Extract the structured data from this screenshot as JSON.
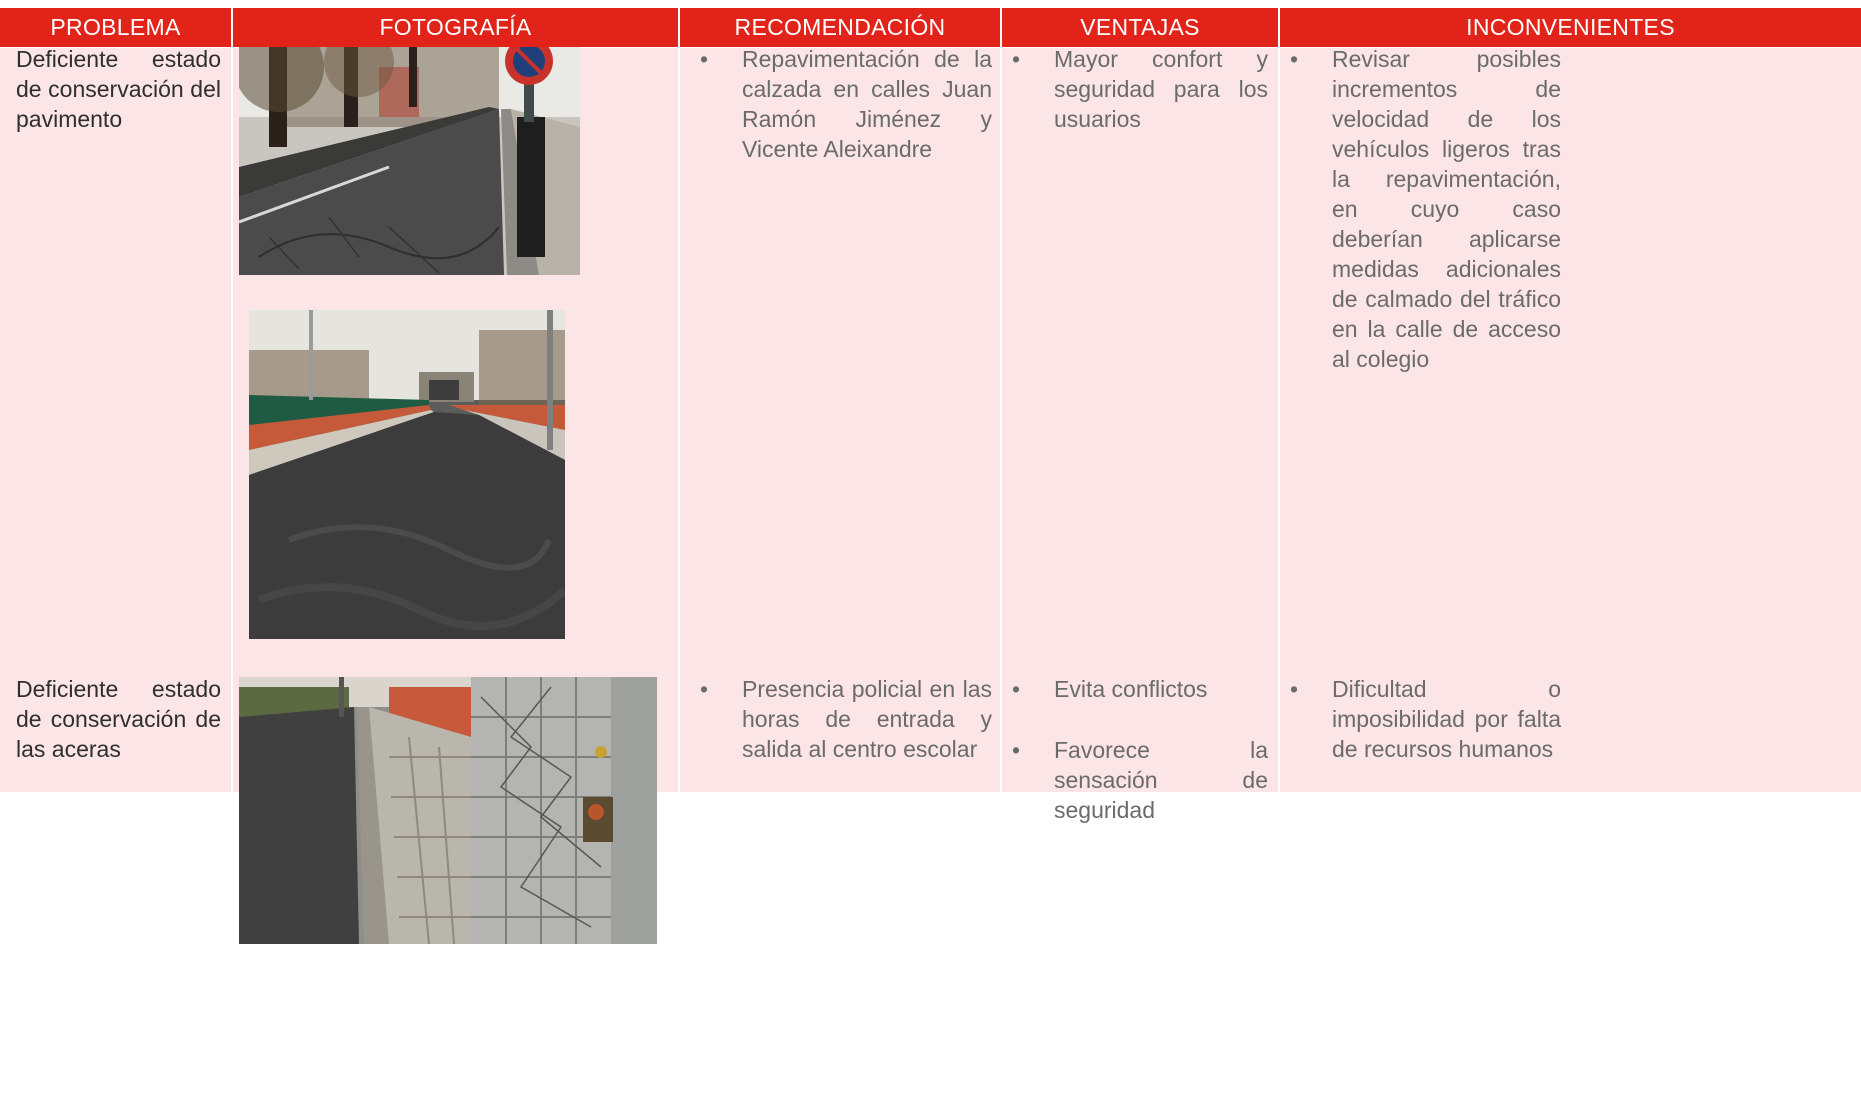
{
  "header": {
    "problema": "PROBLEMA",
    "fotografia": "FOTOGRAFÍA",
    "recomendacion": "RECOMENDACIÓN",
    "ventajas": "VENTAJAS",
    "inconvenientes": "INCONVENIENTES"
  },
  "colors": {
    "header_bg": "#e2231a",
    "row_tint": "#fbe5e6"
  },
  "rows": [
    {
      "problema": "Deficiente estado de conservación del pavimento",
      "recomendacion": [
        "Repavimentación de la calzada en calles Juan Ramón Jiménez y Vicente Aleixandre"
      ],
      "ventajas": [
        "Mayor confort y seguridad para los usuarios"
      ],
      "inconvenientes": [
        "Revisar posibles incrementos de velocidad de los vehículos ligeros tras la repavimentación, en cuyo caso deberían aplicarse medidas adicionales de calmado del tráfico en la calle de acceso al colegio"
      ]
    },
    {
      "problema": "Deficiente estado de conservación de las aceras",
      "recomendacion": [
        "Presencia policial en las horas de entrada y salida al centro escolar"
      ],
      "ventajas": [
        "Evita conflictos",
        "Favorece la sensación de seguridad"
      ],
      "inconvenientes": [
        "Dificultad o imposibilidad por falta de recursos humanos"
      ]
    }
  ]
}
